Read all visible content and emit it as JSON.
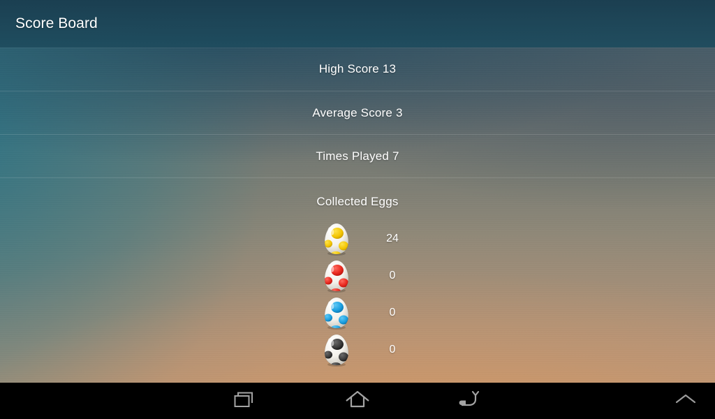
{
  "app": {
    "title": "Score Board"
  },
  "stats": [
    {
      "label": "High Score 13"
    },
    {
      "label": "Average Score 3"
    },
    {
      "label": "Times Played 7"
    }
  ],
  "eggs_section": {
    "title": "Collected Eggs",
    "items": [
      {
        "icon": "egg-icon-yellow",
        "color": "#f2c400",
        "shadow": "#c79a00",
        "count": "24"
      },
      {
        "icon": "egg-icon-red",
        "color": "#e8291f",
        "shadow": "#b8150f",
        "count": "0"
      },
      {
        "icon": "egg-icon-blue",
        "color": "#1b9fe0",
        "shadow": "#0d74ad",
        "count": "0"
      },
      {
        "icon": "egg-icon-black",
        "color": "#3b3b3b",
        "shadow": "#161616",
        "count": "0"
      }
    ]
  },
  "navigation_bar": {
    "buttons": [
      {
        "name": "recents-icon",
        "label": "Recents"
      },
      {
        "name": "home-icon",
        "label": "Home"
      },
      {
        "name": "back-icon",
        "label": "Back"
      }
    ],
    "expand": {
      "name": "chevron-up-icon",
      "label": "Expand"
    }
  },
  "theme": {
    "action_bar_color": "#1e4c5e",
    "text_color": "#ffffff",
    "nav_bar_color": "#000000",
    "divider_color": "rgba(255,255,255,0.13)"
  }
}
